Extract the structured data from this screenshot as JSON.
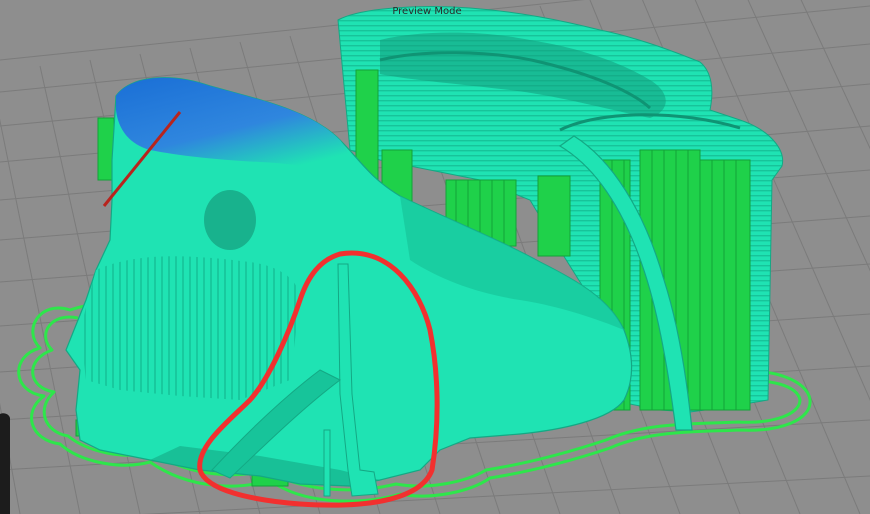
{
  "preview": {
    "mode_label": "Preview Mode"
  },
  "colors": {
    "background": "#8e8e8e",
    "grid_line": "#7b7b7b",
    "model": "#1fe3b3",
    "model_shade": "#16b98f",
    "model_top_layer": "#2f86de",
    "support": "#1fd14a",
    "skirt": "#2ee64b",
    "annotation_circle": "#f2302f",
    "annotation_line": "#b8241d"
  },
  "icons": {
    "annotation": "freehand-circle",
    "pointer": "diagonal-line"
  }
}
